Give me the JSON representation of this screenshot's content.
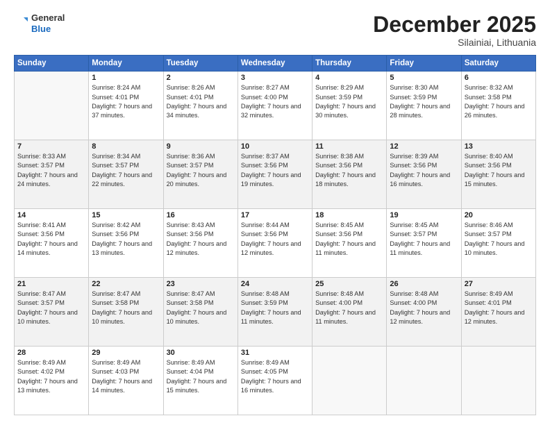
{
  "logo": {
    "general": "General",
    "blue": "Blue"
  },
  "header": {
    "month": "December 2025",
    "location": "Silainiai, Lithuania"
  },
  "weekdays": [
    "Sunday",
    "Monday",
    "Tuesday",
    "Wednesday",
    "Thursday",
    "Friday",
    "Saturday"
  ],
  "weeks": [
    [
      {
        "day": "",
        "sunrise": "",
        "sunset": "",
        "daylight": ""
      },
      {
        "day": "1",
        "sunrise": "Sunrise: 8:24 AM",
        "sunset": "Sunset: 4:01 PM",
        "daylight": "Daylight: 7 hours and 37 minutes."
      },
      {
        "day": "2",
        "sunrise": "Sunrise: 8:26 AM",
        "sunset": "Sunset: 4:01 PM",
        "daylight": "Daylight: 7 hours and 34 minutes."
      },
      {
        "day": "3",
        "sunrise": "Sunrise: 8:27 AM",
        "sunset": "Sunset: 4:00 PM",
        "daylight": "Daylight: 7 hours and 32 minutes."
      },
      {
        "day": "4",
        "sunrise": "Sunrise: 8:29 AM",
        "sunset": "Sunset: 3:59 PM",
        "daylight": "Daylight: 7 hours and 30 minutes."
      },
      {
        "day": "5",
        "sunrise": "Sunrise: 8:30 AM",
        "sunset": "Sunset: 3:59 PM",
        "daylight": "Daylight: 7 hours and 28 minutes."
      },
      {
        "day": "6",
        "sunrise": "Sunrise: 8:32 AM",
        "sunset": "Sunset: 3:58 PM",
        "daylight": "Daylight: 7 hours and 26 minutes."
      }
    ],
    [
      {
        "day": "7",
        "sunrise": "Sunrise: 8:33 AM",
        "sunset": "Sunset: 3:57 PM",
        "daylight": "Daylight: 7 hours and 24 minutes."
      },
      {
        "day": "8",
        "sunrise": "Sunrise: 8:34 AM",
        "sunset": "Sunset: 3:57 PM",
        "daylight": "Daylight: 7 hours and 22 minutes."
      },
      {
        "day": "9",
        "sunrise": "Sunrise: 8:36 AM",
        "sunset": "Sunset: 3:57 PM",
        "daylight": "Daylight: 7 hours and 20 minutes."
      },
      {
        "day": "10",
        "sunrise": "Sunrise: 8:37 AM",
        "sunset": "Sunset: 3:56 PM",
        "daylight": "Daylight: 7 hours and 19 minutes."
      },
      {
        "day": "11",
        "sunrise": "Sunrise: 8:38 AM",
        "sunset": "Sunset: 3:56 PM",
        "daylight": "Daylight: 7 hours and 18 minutes."
      },
      {
        "day": "12",
        "sunrise": "Sunrise: 8:39 AM",
        "sunset": "Sunset: 3:56 PM",
        "daylight": "Daylight: 7 hours and 16 minutes."
      },
      {
        "day": "13",
        "sunrise": "Sunrise: 8:40 AM",
        "sunset": "Sunset: 3:56 PM",
        "daylight": "Daylight: 7 hours and 15 minutes."
      }
    ],
    [
      {
        "day": "14",
        "sunrise": "Sunrise: 8:41 AM",
        "sunset": "Sunset: 3:56 PM",
        "daylight": "Daylight: 7 hours and 14 minutes."
      },
      {
        "day": "15",
        "sunrise": "Sunrise: 8:42 AM",
        "sunset": "Sunset: 3:56 PM",
        "daylight": "Daylight: 7 hours and 13 minutes."
      },
      {
        "day": "16",
        "sunrise": "Sunrise: 8:43 AM",
        "sunset": "Sunset: 3:56 PM",
        "daylight": "Daylight: 7 hours and 12 minutes."
      },
      {
        "day": "17",
        "sunrise": "Sunrise: 8:44 AM",
        "sunset": "Sunset: 3:56 PM",
        "daylight": "Daylight: 7 hours and 12 minutes."
      },
      {
        "day": "18",
        "sunrise": "Sunrise: 8:45 AM",
        "sunset": "Sunset: 3:56 PM",
        "daylight": "Daylight: 7 hours and 11 minutes."
      },
      {
        "day": "19",
        "sunrise": "Sunrise: 8:45 AM",
        "sunset": "Sunset: 3:57 PM",
        "daylight": "Daylight: 7 hours and 11 minutes."
      },
      {
        "day": "20",
        "sunrise": "Sunrise: 8:46 AM",
        "sunset": "Sunset: 3:57 PM",
        "daylight": "Daylight: 7 hours and 10 minutes."
      }
    ],
    [
      {
        "day": "21",
        "sunrise": "Sunrise: 8:47 AM",
        "sunset": "Sunset: 3:57 PM",
        "daylight": "Daylight: 7 hours and 10 minutes."
      },
      {
        "day": "22",
        "sunrise": "Sunrise: 8:47 AM",
        "sunset": "Sunset: 3:58 PM",
        "daylight": "Daylight: 7 hours and 10 minutes."
      },
      {
        "day": "23",
        "sunrise": "Sunrise: 8:47 AM",
        "sunset": "Sunset: 3:58 PM",
        "daylight": "Daylight: 7 hours and 10 minutes."
      },
      {
        "day": "24",
        "sunrise": "Sunrise: 8:48 AM",
        "sunset": "Sunset: 3:59 PM",
        "daylight": "Daylight: 7 hours and 11 minutes."
      },
      {
        "day": "25",
        "sunrise": "Sunrise: 8:48 AM",
        "sunset": "Sunset: 4:00 PM",
        "daylight": "Daylight: 7 hours and 11 minutes."
      },
      {
        "day": "26",
        "sunrise": "Sunrise: 8:48 AM",
        "sunset": "Sunset: 4:00 PM",
        "daylight": "Daylight: 7 hours and 12 minutes."
      },
      {
        "day": "27",
        "sunrise": "Sunrise: 8:49 AM",
        "sunset": "Sunset: 4:01 PM",
        "daylight": "Daylight: 7 hours and 12 minutes."
      }
    ],
    [
      {
        "day": "28",
        "sunrise": "Sunrise: 8:49 AM",
        "sunset": "Sunset: 4:02 PM",
        "daylight": "Daylight: 7 hours and 13 minutes."
      },
      {
        "day": "29",
        "sunrise": "Sunrise: 8:49 AM",
        "sunset": "Sunset: 4:03 PM",
        "daylight": "Daylight: 7 hours and 14 minutes."
      },
      {
        "day": "30",
        "sunrise": "Sunrise: 8:49 AM",
        "sunset": "Sunset: 4:04 PM",
        "daylight": "Daylight: 7 hours and 15 minutes."
      },
      {
        "day": "31",
        "sunrise": "Sunrise: 8:49 AM",
        "sunset": "Sunset: 4:05 PM",
        "daylight": "Daylight: 7 hours and 16 minutes."
      },
      {
        "day": "",
        "sunrise": "",
        "sunset": "",
        "daylight": ""
      },
      {
        "day": "",
        "sunrise": "",
        "sunset": "",
        "daylight": ""
      },
      {
        "day": "",
        "sunrise": "",
        "sunset": "",
        "daylight": ""
      }
    ]
  ]
}
